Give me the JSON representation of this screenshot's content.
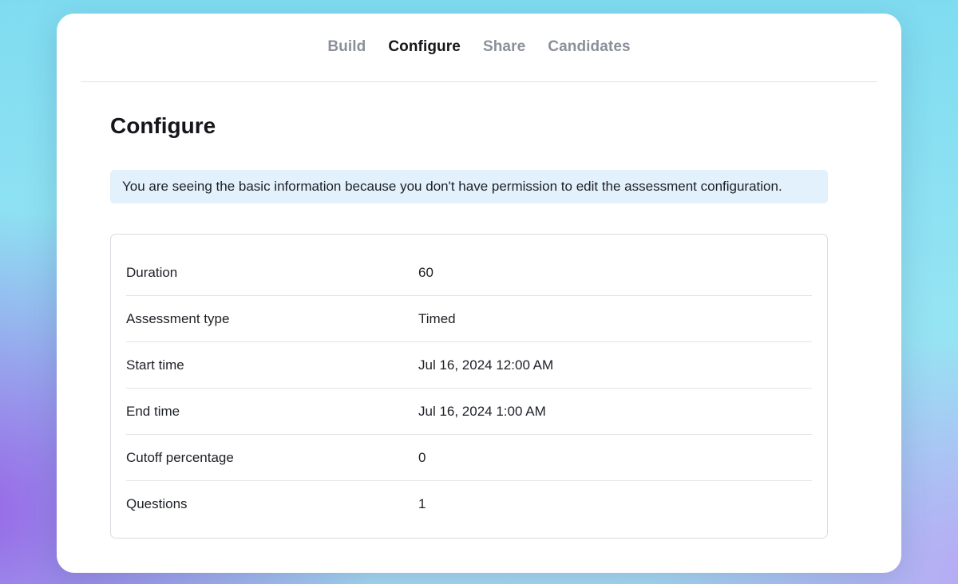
{
  "tabs": [
    {
      "label": "Build",
      "active": false
    },
    {
      "label": "Configure",
      "active": true
    },
    {
      "label": "Share",
      "active": false
    },
    {
      "label": "Candidates",
      "active": false
    }
  ],
  "page": {
    "title": "Configure",
    "notice": "You are seeing the basic information because you don't have permission to edit the assessment configuration."
  },
  "details": [
    {
      "label": "Duration",
      "value": "60"
    },
    {
      "label": "Assessment type",
      "value": "Timed"
    },
    {
      "label": "Start time",
      "value": "Jul 16, 2024 12:00 AM"
    },
    {
      "label": "End time",
      "value": "Jul 16, 2024 1:00 AM"
    },
    {
      "label": "Cutoff percentage",
      "value": "0"
    },
    {
      "label": "Questions",
      "value": "1"
    }
  ],
  "colors": {
    "active_tab": "#14161a",
    "inactive_tab": "#8a9099",
    "notice_bg": "#e3f1fc"
  }
}
